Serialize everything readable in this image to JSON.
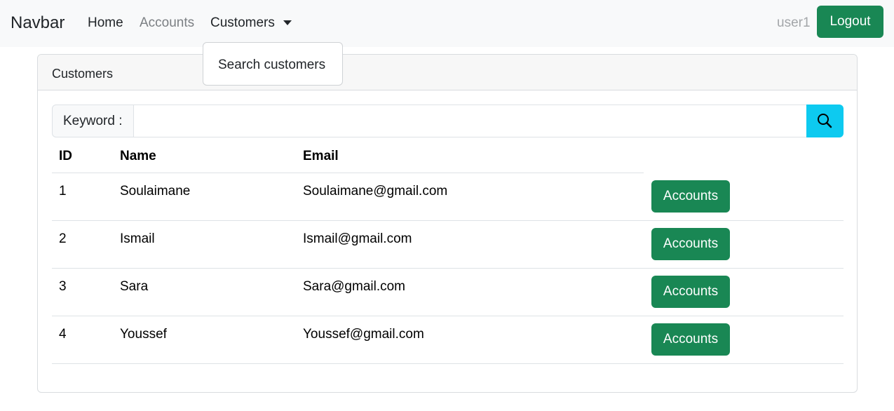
{
  "navbar": {
    "brand": "Navbar",
    "links": {
      "home": "Home",
      "accounts": "Accounts",
      "customers": "Customers"
    },
    "user": "user1",
    "logout_label": "Logout"
  },
  "dropdown": {
    "items": [
      "Search customers"
    ]
  },
  "card": {
    "title": "Customers",
    "search": {
      "label": "Keyword :",
      "value": "",
      "icon": "search-icon"
    },
    "table": {
      "headers": {
        "id": "ID",
        "name": "Name",
        "email": "Email"
      },
      "rows": [
        {
          "id": "1",
          "name": "Soulaimane",
          "email": "Soulaimane@gmail.com",
          "action": "Accounts"
        },
        {
          "id": "2",
          "name": "Ismail",
          "email": "Ismail@gmail.com",
          "action": "Accounts"
        },
        {
          "id": "3",
          "name": "Sara",
          "email": "Sara@gmail.com",
          "action": "Accounts"
        },
        {
          "id": "4",
          "name": "Youssef",
          "email": "Youssef@gmail.com",
          "action": "Accounts"
        }
      ]
    }
  },
  "colors": {
    "primary_green": "#198754",
    "info_cyan": "#0dcaf0",
    "navbar_bg": "#f8f9fa"
  }
}
